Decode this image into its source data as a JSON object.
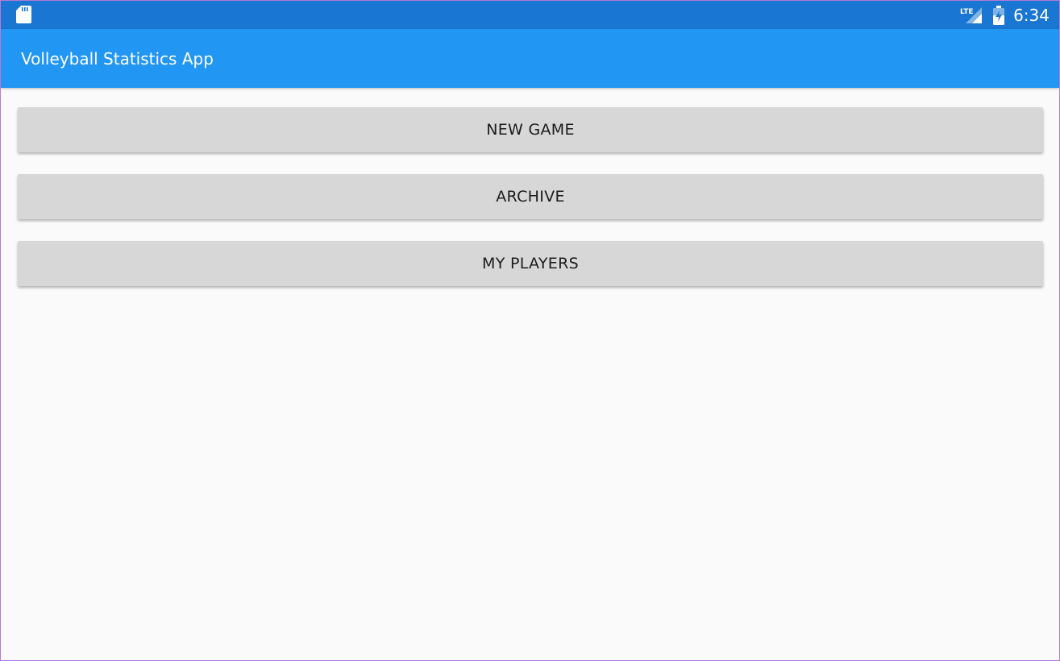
{
  "status_bar": {
    "time": "6:34",
    "icons": [
      "sd-card-icon",
      "lte-signal-icon",
      "battery-charging-icon"
    ],
    "lte_label": "LTE",
    "color": "#1976d2"
  },
  "app_bar": {
    "title": "Volleyball Statistics App",
    "color": "#2196f3"
  },
  "menu": {
    "new_game": "NEW GAME",
    "archive": "ARCHIVE",
    "my_players": "MY PLAYERS"
  }
}
